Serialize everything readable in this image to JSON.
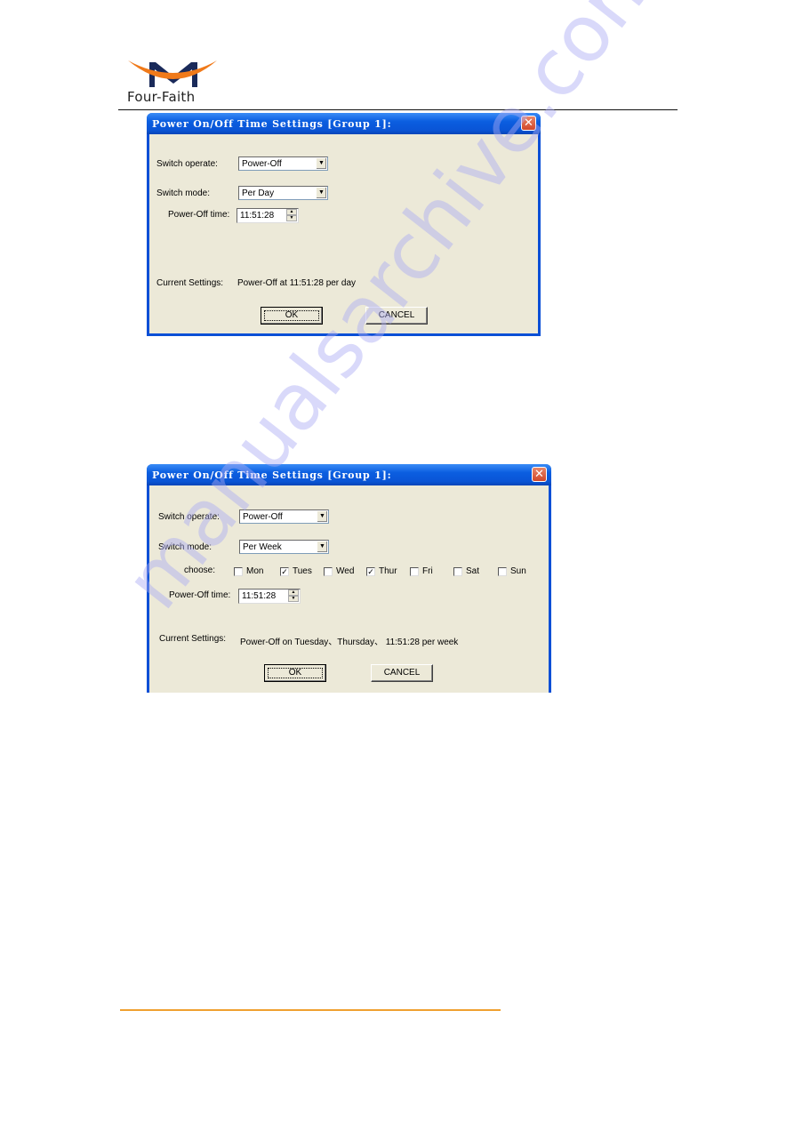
{
  "header": {
    "brand": "Four-Faith",
    "logo_colors": {
      "arc": "#f07a1a",
      "mark": "#1a2a5a"
    }
  },
  "footer": {
    "rule_color": "#f0a030"
  },
  "watermark": "manualsarchive.com",
  "dialogs": [
    {
      "title": "Power On/Off Time Settings [Group 1]:",
      "switch_operate_label": "Switch operate:",
      "switch_operate_value": "Power-Off",
      "switch_mode_label": "Switch  mode:",
      "switch_mode_value": "Per Day",
      "time_label": "Power-Off time:",
      "time_value": "11:51:28",
      "current_label": "Current Settings:",
      "current_value": "Power-Off at 11:51:28 per day",
      "ok_label": "OK",
      "cancel_label": "CANCEL"
    },
    {
      "title": "Power On/Off Time Settings [Group 1]:",
      "switch_operate_label": "Switch operate:",
      "switch_operate_value": "Power-Off",
      "switch_mode_label": "Switch  mode:",
      "switch_mode_value": "Per Week",
      "choose_label": "choose:",
      "days": [
        {
          "label": "Mon",
          "checked": false
        },
        {
          "label": "Tues",
          "checked": true
        },
        {
          "label": "Wed",
          "checked": false
        },
        {
          "label": "Thur",
          "checked": true
        },
        {
          "label": "Fri",
          "checked": false
        },
        {
          "label": "Sat",
          "checked": false
        },
        {
          "label": "Sun",
          "checked": false
        }
      ],
      "time_label": "Power-Off time:",
      "time_value": "11:51:28",
      "current_label": "Current Settings:",
      "current_value": "Power-Off on Tuesday、Thursday、 11:51:28 per week",
      "ok_label": "OK",
      "cancel_label": "CANCEL"
    }
  ],
  "icons": {
    "close": "close-icon",
    "dropdown": "chevron-down-icon",
    "spin_up": "spin-up-icon",
    "spin_down": "spin-down-icon",
    "check": "checkmark-icon"
  }
}
